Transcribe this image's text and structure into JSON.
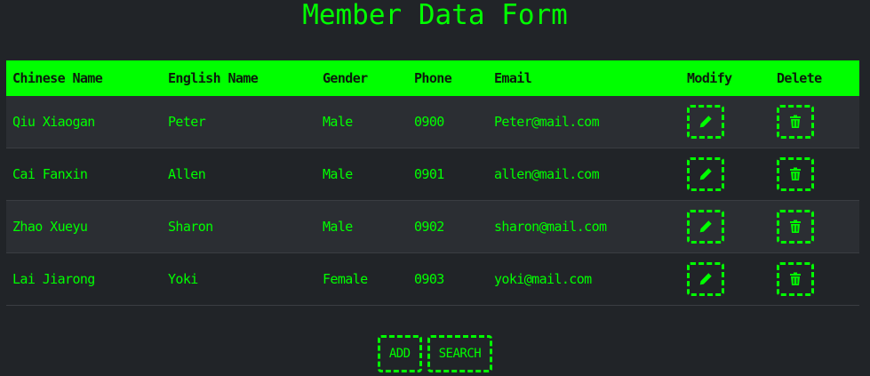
{
  "page": {
    "title": "Member Data Form"
  },
  "table": {
    "headers": {
      "chinese_name": "Chinese Name",
      "english_name": "English Name",
      "gender": "Gender",
      "phone": "Phone",
      "email": "Email",
      "modify": "Modify",
      "delete": "Delete"
    },
    "rows": [
      {
        "chinese_name": "Qiu Xiaogan",
        "english_name": "Peter",
        "gender": "Male",
        "phone": "0900",
        "email": "Peter@mail.com"
      },
      {
        "chinese_name": "Cai Fanxin",
        "english_name": "Allen",
        "gender": "Male",
        "phone": "0901",
        "email": "allen@mail.com"
      },
      {
        "chinese_name": "Zhao Xueyu",
        "english_name": "Sharon",
        "gender": "Male",
        "phone": "0902",
        "email": "sharon@mail.com"
      },
      {
        "chinese_name": "Lai Jiarong",
        "english_name": "Yoki",
        "gender": "Female",
        "phone": "0903",
        "email": "yoki@mail.com"
      }
    ],
    "modify_icon": "pencil-icon",
    "delete_icon": "trash-icon"
  },
  "actions": {
    "add_label": "ADD",
    "search_label": "SEARCH"
  },
  "colors": {
    "background": "#212428",
    "accent": "#00ff00",
    "row_alt": "#2b2e33"
  }
}
